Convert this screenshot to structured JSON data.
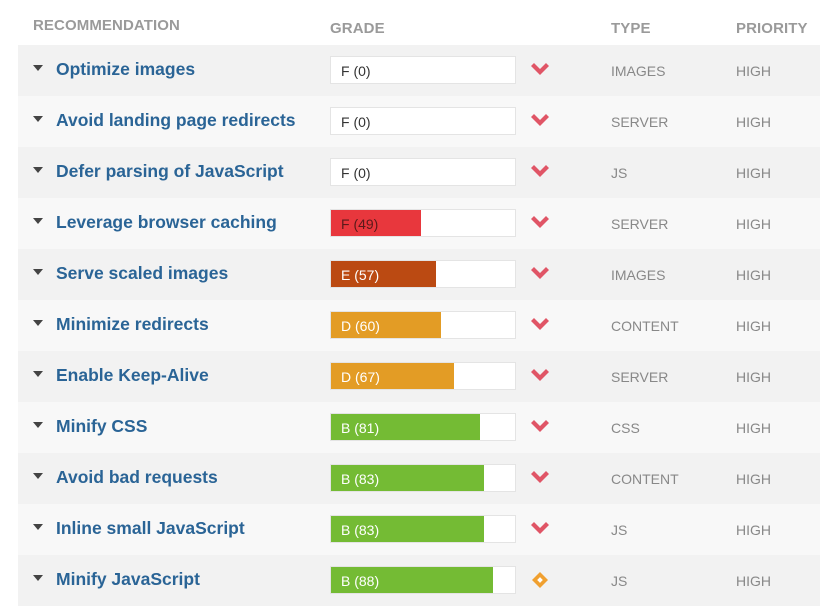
{
  "header": {
    "recommendation": "RECOMMENDATION",
    "grade": "GRADE",
    "type": "TYPE",
    "priority": "PRIORITY"
  },
  "colors": {
    "link": "#2a6496",
    "grade_f_red": "#e8373d",
    "grade_e_brown": "#bb4a12",
    "grade_d_orange": "#e39c25",
    "grade_b_green": "#74bb34",
    "icon_down_red": "#e05566",
    "icon_neutral_orange": "#f0a030"
  },
  "rows": [
    {
      "label": "Optimize images",
      "grade": "F (0)",
      "score": 0,
      "fill": "#e8373d",
      "text_style": "dark",
      "trend": "chevron-down",
      "type": "IMAGES",
      "priority": "HIGH"
    },
    {
      "label": "Avoid landing page redirects",
      "grade": "F (0)",
      "score": 0,
      "fill": "#e8373d",
      "text_style": "dark",
      "trend": "chevron-down",
      "type": "SERVER",
      "priority": "HIGH"
    },
    {
      "label": "Defer parsing of JavaScript",
      "grade": "F (0)",
      "score": 0,
      "fill": "#e8373d",
      "text_style": "dark",
      "trend": "chevron-down",
      "type": "JS",
      "priority": "HIGH"
    },
    {
      "label": "Leverage browser caching",
      "grade": "F (49)",
      "score": 49,
      "fill": "#e8373d",
      "text_style": "darkred",
      "trend": "chevron-down",
      "type": "SERVER",
      "priority": "HIGH"
    },
    {
      "label": "Serve scaled images",
      "grade": "E (57)",
      "score": 57,
      "fill": "#bb4a12",
      "text_style": "light",
      "trend": "chevron-down",
      "type": "IMAGES",
      "priority": "HIGH"
    },
    {
      "label": "Minimize redirects",
      "grade": "D (60)",
      "score": 60,
      "fill": "#e39c25",
      "text_style": "light",
      "trend": "chevron-down",
      "type": "CONTENT",
      "priority": "HIGH"
    },
    {
      "label": "Enable Keep-Alive",
      "grade": "D (67)",
      "score": 67,
      "fill": "#e39c25",
      "text_style": "light",
      "trend": "chevron-down",
      "type": "SERVER",
      "priority": "HIGH"
    },
    {
      "label": "Minify CSS",
      "grade": "B (81)",
      "score": 81,
      "fill": "#74bb34",
      "text_style": "light",
      "trend": "chevron-down",
      "type": "CSS",
      "priority": "HIGH"
    },
    {
      "label": "Avoid bad requests",
      "grade": "B (83)",
      "score": 83,
      "fill": "#74bb34",
      "text_style": "light",
      "trend": "chevron-down",
      "type": "CONTENT",
      "priority": "HIGH"
    },
    {
      "label": "Inline small JavaScript",
      "grade": "B (83)",
      "score": 83,
      "fill": "#74bb34",
      "text_style": "light",
      "trend": "chevron-down",
      "type": "JS",
      "priority": "HIGH"
    },
    {
      "label": "Minify JavaScript",
      "grade": "B (88)",
      "score": 88,
      "fill": "#74bb34",
      "text_style": "light",
      "trend": "diamond",
      "type": "JS",
      "priority": "HIGH"
    }
  ]
}
